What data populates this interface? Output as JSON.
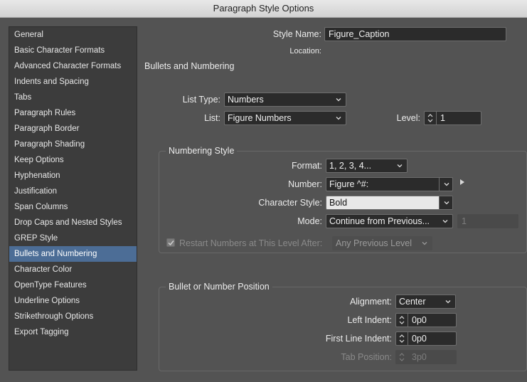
{
  "window": {
    "title": "Paragraph Style Options"
  },
  "sidebar": {
    "items": [
      {
        "label": "General"
      },
      {
        "label": "Basic Character Formats"
      },
      {
        "label": "Advanced Character Formats"
      },
      {
        "label": "Indents and Spacing"
      },
      {
        "label": "Tabs"
      },
      {
        "label": "Paragraph Rules"
      },
      {
        "label": "Paragraph Border"
      },
      {
        "label": "Paragraph Shading"
      },
      {
        "label": "Keep Options"
      },
      {
        "label": "Hyphenation"
      },
      {
        "label": "Justification"
      },
      {
        "label": "Span Columns"
      },
      {
        "label": "Drop Caps and Nested Styles"
      },
      {
        "label": "GREP Style"
      },
      {
        "label": "Bullets and Numbering"
      },
      {
        "label": "Character Color"
      },
      {
        "label": "OpenType Features"
      },
      {
        "label": "Underline Options"
      },
      {
        "label": "Strikethrough Options"
      },
      {
        "label": "Export Tagging"
      }
    ],
    "selected": "Bullets and Numbering"
  },
  "header": {
    "style_name_label": "Style Name:",
    "style_name_value": "Figure_Caption",
    "location_label": "Location:"
  },
  "section_title": "Bullets and Numbering",
  "list": {
    "list_type_label": "List Type:",
    "list_type_value": "Numbers",
    "list_label": "List:",
    "list_value": "Figure Numbers",
    "level_label": "Level:",
    "level_value": "1"
  },
  "numbering_style": {
    "title": "Numbering Style",
    "format_label": "Format:",
    "format_value": "1, 2, 3, 4...",
    "number_label": "Number:",
    "number_value": "Figure ^#:",
    "char_style_label": "Character Style:",
    "char_style_value": "Bold",
    "mode_label": "Mode:",
    "mode_value": "Continue from Previous...",
    "mode_number": "1",
    "restart_label": "Restart Numbers at This Level After:",
    "restart_value": "Any Previous Level",
    "restart_checked": true
  },
  "position": {
    "title": "Bullet or Number Position",
    "alignment_label": "Alignment:",
    "alignment_value": "Center",
    "left_indent_label": "Left Indent:",
    "left_indent_value": "0p0",
    "first_line_label": "First Line Indent:",
    "first_line_value": "0p0",
    "tab_position_label": "Tab Position:",
    "tab_position_value": "3p0"
  },
  "icons": {
    "chevron": "chevron-down-icon",
    "stepper": "up-down-stepper-icon",
    "insert_special": "triangle-right-icon",
    "check": "checkmark-icon"
  },
  "colors": {
    "background": "#535353",
    "sidebar": "#3c3c3c",
    "selection": "#4c6d96",
    "field": "#2b2b2b"
  }
}
